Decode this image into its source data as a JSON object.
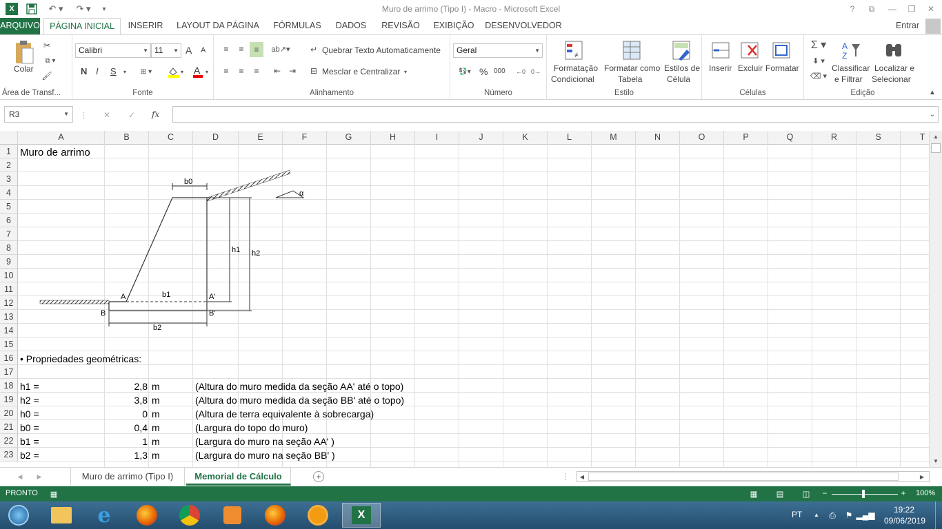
{
  "window": {
    "title": "Muro de arrimo (Tipo I) - Macro - Microsoft Excel",
    "help": "?"
  },
  "tabs": [
    "ARQUIVO",
    "PÁGINA INICIAL",
    "INSERIR",
    "LAYOUT DA PÁGINA",
    "FÓRMULAS",
    "DADOS",
    "REVISÃO",
    "EXIBIÇÃO",
    "DESENVOLVEDOR"
  ],
  "account": "Entrar",
  "ribbon": {
    "clipboard": {
      "paste": "Colar",
      "label": "Área de Transf..."
    },
    "font": {
      "name": "Calibri",
      "size": "11",
      "grow": "A",
      "shrink": "A",
      "bold": "N",
      "italic": "I",
      "underline": "S",
      "label": "Fonte"
    },
    "alignment": {
      "wrap": "Quebrar Texto Automaticamente",
      "merge": "Mesclar e Centralizar",
      "label": "Alinhamento"
    },
    "number": {
      "format": "Geral",
      "percent": "%",
      "thousands": "000",
      "label": "Número"
    },
    "styles": {
      "cond1": "Formatação",
      "cond2": "Condicional",
      "table1": "Formatar como",
      "table2": "Tabela",
      "cell1": "Estilos de",
      "cell2": "Célula",
      "label": "Estilo"
    },
    "cells": {
      "insert": "Inserir",
      "delete": "Excluir",
      "format": "Formatar",
      "label": "Células"
    },
    "editing": {
      "sort1": "Classificar",
      "sort2": "e Filtrar",
      "find1": "Localizar e",
      "find2": "Selecionar",
      "label": "Edição"
    }
  },
  "formula_bar": {
    "name_box": "R3",
    "fx": "fx",
    "value": ""
  },
  "columns": [
    "A",
    "B",
    "C",
    "D",
    "E",
    "F",
    "G",
    "H",
    "I",
    "J",
    "K",
    "L",
    "M",
    "N",
    "O",
    "P",
    "Q",
    "R",
    "S",
    "T"
  ],
  "rows": [
    "1",
    "2",
    "3",
    "4",
    "5",
    "6",
    "7",
    "8",
    "9",
    "10",
    "11",
    "12",
    "13",
    "14",
    "15",
    "16",
    "17",
    "18",
    "19",
    "20",
    "21",
    "22",
    "23"
  ],
  "cells": {
    "a1": "Muro de arrimo",
    "a16": "• Propriedades geométricas:",
    "params": [
      {
        "label": "h1 =",
        "value": "2,8",
        "unit": "m",
        "desc": "(Altura do muro medida da seção AA' até o topo)"
      },
      {
        "label": "h2 =",
        "value": "3,8",
        "unit": "m",
        "desc": "(Altura do muro medida da seção BB' até o topo)"
      },
      {
        "label": "h0 =",
        "value": "0",
        "unit": "m",
        "desc": "(Altura de terra equivalente à sobrecarga)"
      },
      {
        "label": "b0 =",
        "value": "0,4",
        "unit": "m",
        "desc": "(Largura do topo do muro)"
      },
      {
        "label": "b1 =",
        "value": "1",
        "unit": "m",
        "desc": "(Largura do muro na seção AA' )"
      },
      {
        "label": "b2 =",
        "value": "1,3",
        "unit": "m",
        "desc": "(Largura do muro na seção BB' )"
      }
    ]
  },
  "diagram": {
    "b0": "b0",
    "b1": "b1",
    "b2": "b2",
    "h1": "h1",
    "h2": "h2",
    "A": "A",
    "A2": "A'",
    "B": "B",
    "B2": "B'",
    "alpha": "α"
  },
  "sheets": [
    "Muro de arrimo (Tipo I)",
    "Memorial de Cálculo"
  ],
  "status": {
    "mode": "PRONTO",
    "zoom": "100%"
  },
  "taskbar": {
    "lang": "PT",
    "time": "19:22",
    "date": "09/06/2019"
  },
  "colors": {
    "accent": "#217346"
  }
}
